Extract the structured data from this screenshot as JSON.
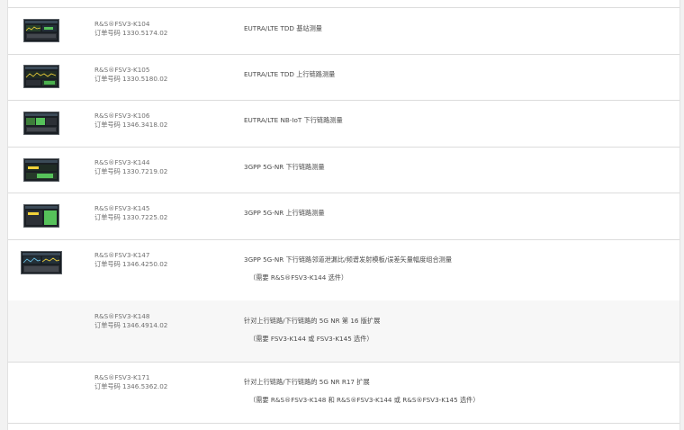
{
  "rows": [
    {
      "model": "R&S®FSV3-K104",
      "order": "订单号码 1330.5174.02",
      "desc": "EUTRA/LTE TDD 基站测量",
      "note": "",
      "thumb": "lte-tdd-bs-screenshot"
    },
    {
      "model": "R&S®FSV3-K105",
      "order": "订单号码 1330.5180.02",
      "desc": "EUTRA/LTE TDD 上行链路测量",
      "note": "",
      "thumb": "lte-tdd-ul-screenshot"
    },
    {
      "model": "R&S®FSV3-K106",
      "order": "订单号码 1346.3418.02",
      "desc": "EUTRA/LTE NB-IoT 下行链路测量",
      "note": "",
      "thumb": "nb-iot-dl-screenshot"
    },
    {
      "model": "R&S®FSV3-K144",
      "order": "订单号码 1330.7219.02",
      "desc": "3GPP 5G-NR 下行链路测量",
      "note": "",
      "thumb": "5g-nr-dl-screenshot"
    },
    {
      "model": "R&S®FSV3-K145",
      "order": "订单号码 1330.7225.02",
      "desc": "3GPP 5G-NR 上行链路测量",
      "note": "",
      "thumb": "5g-nr-ul-screenshot"
    },
    {
      "model": "R&S®FSV3-K147",
      "order": "订单号码 1346.4250.02",
      "desc": "3GPP 5G-NR 下行链路邻道泄漏比/频谱发射模板/误差矢量幅度组合测量",
      "note": "（需要 R&S®FSV3-K144 选件）",
      "thumb": "5g-nr-combined-screenshot"
    },
    {
      "model": "R&S®FSV3-K148",
      "order": "订单号码 1346.4914.02",
      "desc": "针对上行链路/下行链路的 5G NR 第 16 版扩展",
      "note": "（需要 FSV3-K144 或 FSV3-K145 选件）",
      "thumb": ""
    },
    {
      "model": "R&S®FSV3-K171",
      "order": "订单号码 1346.5362.02",
      "desc": "针对上行链路/下行链路的 5G NR R17 扩展",
      "note": "（需要 R&S®FSV3-K148 和 R&S®FSV3-K144 或 R&S®FSV3-K145 选件）",
      "thumb": ""
    }
  ]
}
